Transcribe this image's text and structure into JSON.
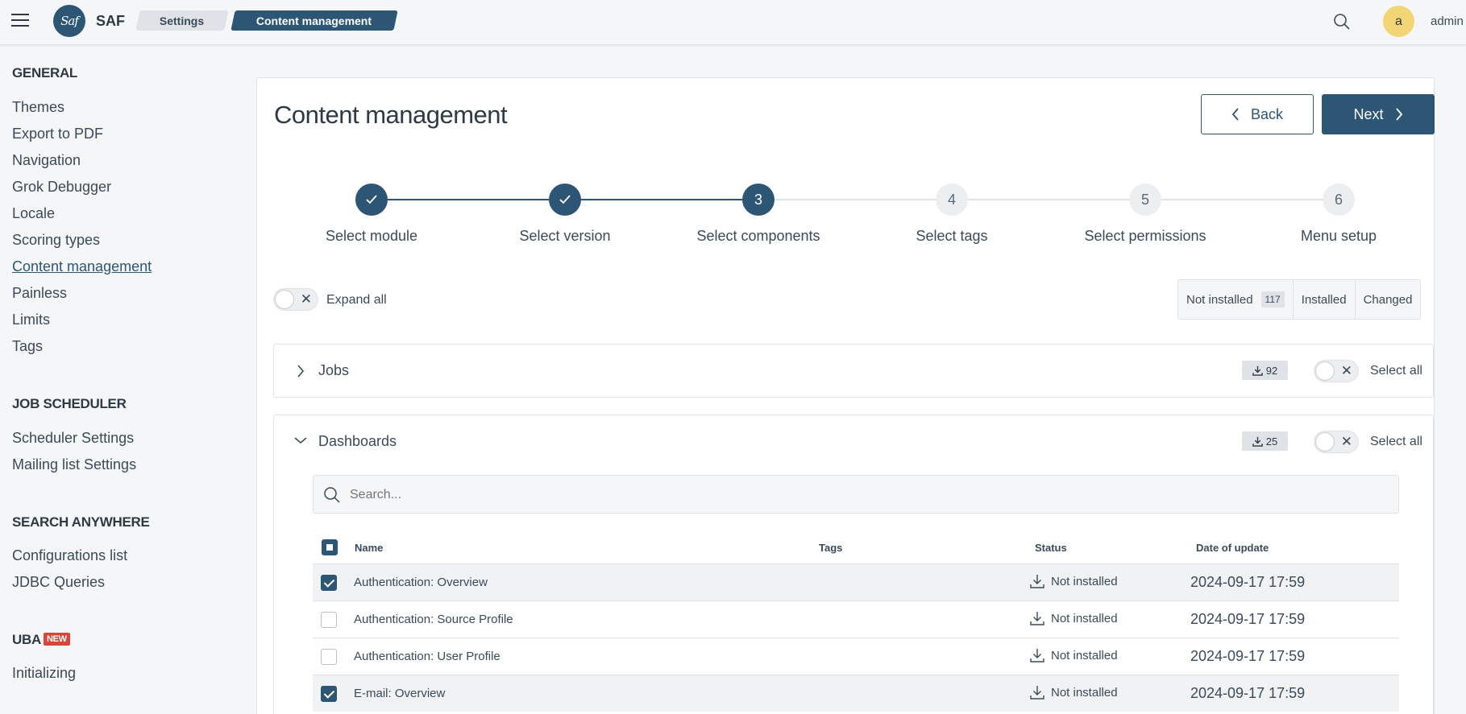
{
  "header": {
    "brand": "SAF",
    "logo_text": "Saf",
    "breadcrumb": [
      "Settings",
      "Content management"
    ],
    "user_initial": "a",
    "user_name": "admin"
  },
  "sidebar": {
    "sections": [
      {
        "title": "GENERAL",
        "items": [
          "Themes",
          "Export to PDF",
          "Navigation",
          "Grok Debugger",
          "Locale",
          "Scoring types",
          "Content management",
          "Painless",
          "Limits",
          "Tags"
        ]
      },
      {
        "title": "JOB SCHEDULER",
        "items": [
          "Scheduler Settings",
          "Mailing list Settings"
        ]
      },
      {
        "title": "SEARCH ANYWHERE",
        "items": [
          "Configurations list",
          "JDBC Queries"
        ]
      },
      {
        "title": "UBA",
        "badge": "NEW",
        "items": [
          "Initializing"
        ]
      }
    ],
    "active_item": "Content management"
  },
  "main": {
    "title": "Content management",
    "back_label": "Back",
    "next_label": "Next",
    "steps": [
      {
        "label": "Select module",
        "num": "1",
        "state": "done"
      },
      {
        "label": "Select version",
        "num": "2",
        "state": "done"
      },
      {
        "label": "Select components",
        "num": "3",
        "state": "current"
      },
      {
        "label": "Select tags",
        "num": "4",
        "state": "todo"
      },
      {
        "label": "Select permissions",
        "num": "5",
        "state": "todo"
      },
      {
        "label": "Menu setup",
        "num": "6",
        "state": "todo"
      }
    ],
    "expand_all_label": "Expand all",
    "filters": {
      "not_installed": "Not installed",
      "not_installed_count": "117",
      "installed": "Installed",
      "changed": "Changed"
    },
    "accordions": [
      {
        "title": "Jobs",
        "count": "92",
        "select_all": "Select all",
        "expanded": false
      },
      {
        "title": "Dashboards",
        "count": "25",
        "select_all": "Select all",
        "expanded": true
      }
    ],
    "search_placeholder": "Search...",
    "table": {
      "columns": [
        "Name",
        "Tags",
        "Status",
        "Date of update"
      ],
      "rows": [
        {
          "name": "Authentication: Overview",
          "tags": "",
          "status": "Not installed",
          "date": "2024-09-17 17:59",
          "checked": true
        },
        {
          "name": "Authentication: Source Profile",
          "tags": "",
          "status": "Not installed",
          "date": "2024-09-17 17:59",
          "checked": false
        },
        {
          "name": "Authentication: User Profile",
          "tags": "",
          "status": "Not installed",
          "date": "2024-09-17 17:59",
          "checked": false
        },
        {
          "name": "E-mail: Overview",
          "tags": "",
          "status": "Not installed",
          "date": "2024-09-17 17:59",
          "checked": true
        }
      ]
    }
  },
  "colors": {
    "primary": "#2d5574",
    "avatar": "#f2d675",
    "badge_new": "#d9443b"
  }
}
